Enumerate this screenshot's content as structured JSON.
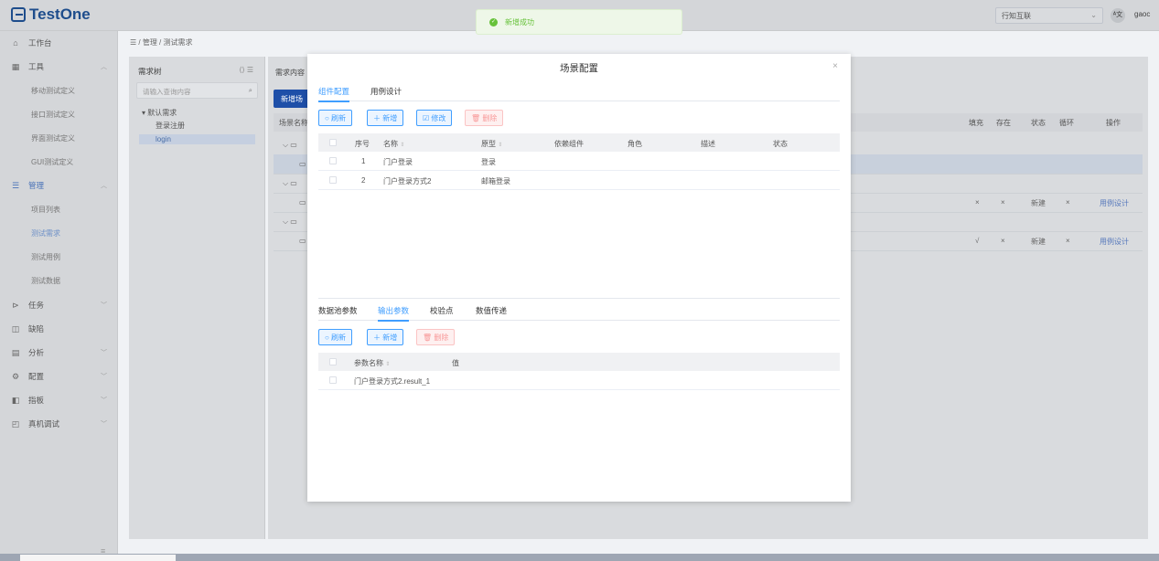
{
  "app": {
    "logo_text": "TestOne"
  },
  "header": {
    "org_select": "行知互联",
    "lang": "ᴬ文",
    "user": "gaoc"
  },
  "toast": {
    "message": "新增成功"
  },
  "sidebar": {
    "items": [
      {
        "label": "工作台",
        "icon": "home-icon"
      },
      {
        "label": "工具",
        "icon": "grid-icon"
      },
      {
        "label": "管理",
        "icon": "list-icon"
      },
      {
        "label": "任务",
        "icon": "send-icon"
      },
      {
        "label": "缺陷",
        "icon": "bug-icon"
      },
      {
        "label": "分析",
        "icon": "calendar-icon"
      },
      {
        "label": "配置",
        "icon": "gear-icon"
      },
      {
        "label": "指板",
        "icon": "panel-icon"
      },
      {
        "label": "真机调试",
        "icon": "device-icon"
      }
    ],
    "tool_subs": [
      "移动测试定义",
      "接口测试定义",
      "界面测试定义",
      "GUI测试定义"
    ],
    "manage_subs": [
      "项目列表",
      "测试需求",
      "测试用例",
      "测试数据"
    ]
  },
  "breadcrumb": "☰ / 管理 / 测试需求",
  "tree": {
    "title": "需求树",
    "search_placeholder": "请输入查询内容",
    "nodes": [
      "▾ 默认需求",
      "登录注册",
      "login"
    ]
  },
  "main": {
    "label": "需求内容",
    "add_btn": "新增场",
    "columns": [
      "场景名称",
      "填充",
      "存在",
      "状态",
      "循环",
      "操作"
    ],
    "rows": [
      {
        "fill": "×",
        "exist": "×",
        "status": "新建",
        "loop": "×",
        "op": "用例设计"
      },
      {
        "fill": "√",
        "exist": "×",
        "status": "新建",
        "loop": "×",
        "op": "用例设计"
      }
    ]
  },
  "dialog": {
    "title": "场景配置",
    "close": "×",
    "top_tabs": [
      "组件配置",
      "用例设计"
    ],
    "top_buttons": [
      "○ 刷新",
      "＋ 新增",
      "☑ 修改",
      "🗑 删除"
    ],
    "top_columns": [
      "序号",
      "名称",
      "原型",
      "依赖组件",
      "角色",
      "描述",
      "状态"
    ],
    "top_rows": [
      {
        "no": "1",
        "name": "门户登录",
        "proto": "登录"
      },
      {
        "no": "2",
        "name": "门户登录方式2",
        "proto": "邮箱登录"
      }
    ],
    "bottom_tabs": [
      "数据池参数",
      "输出参数",
      "校验点",
      "数值传递"
    ],
    "bottom_buttons": [
      "○ 刷新",
      "＋ 新增",
      "🗑 删除"
    ],
    "bottom_columns": [
      "参数名称",
      "值"
    ],
    "bottom_rows": [
      {
        "name": "门户登录方式2.result_1"
      }
    ]
  },
  "colors": {
    "primary": "#409eff",
    "success": "#67c23a",
    "brand": "#1e4d8c"
  }
}
